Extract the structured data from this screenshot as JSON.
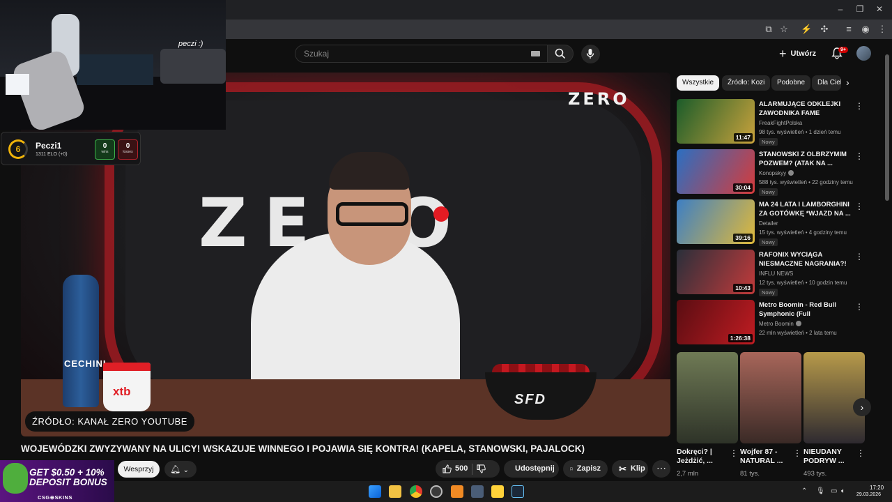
{
  "header": {
    "search_placeholder": "Szukaj",
    "create_label": "Utwórz",
    "notifications_badge": "9+"
  },
  "video": {
    "caption": "ŹRÓDŁO: KANAŁ ZERO YOUTUBE",
    "title": "WOJEWÓDZKI ZWYZYWANY NA ULICY! WSKAZUJE WINNEGO I POJAWIA SIĘ KONTRA! (KAPELA, STANOWSKI, PAJALOCK)",
    "brand_big": "ZERO",
    "brand_small": "ZERO",
    "bottle_label": "CECHINI",
    "mug_label": "xtb",
    "bowl_label": "SFD"
  },
  "actions": {
    "support": "Wesprzyj",
    "likes": "500",
    "share": "Udostępnij",
    "save": "Zapisz",
    "clip": "Klip"
  },
  "chips": [
    "Wszystkie",
    "Źródło: Kozi",
    "Podobne",
    "Dla Ciebie"
  ],
  "recommendations": [
    {
      "title": "ALARMUJĄCE ODKLEJKI ZAWODNIKA FAME (TAŃCULA...",
      "channel": "FreakFightPolska",
      "meta": "98 tys. wyświetleń • 1 dzień temu",
      "badge": "Nowy",
      "duration": "11:47",
      "verified": false,
      "c1": "#1b5c2a",
      "c2": "#c9a23c"
    },
    {
      "title": "STANOWSKI Z OLBRZYMIM POZWEM? (ATAK NA ...",
      "channel": "Konopskyy",
      "meta": "588 tys. wyświetleń • 22 godziny temu",
      "badge": "Nowy",
      "duration": "30:04",
      "verified": true,
      "c1": "#2b6fc2",
      "c2": "#d63b3b"
    },
    {
      "title": "MA 24 LATA I LAMBORGHINI ZA GOTÓWKĘ *WJAZD NA ...",
      "channel": "Detailer",
      "meta": "15 tys. wyświetleń • 4 godziny temu",
      "badge": "Nowy",
      "duration": "39:16",
      "verified": false,
      "c1": "#3d7fc4",
      "c2": "#e0b93a"
    },
    {
      "title": "RAFONIX WYCIĄGA NIESMACZNE NAGRANIA?! ...",
      "channel": "INFLU NEWS",
      "meta": "12 tys. wyświetleń • 10 godzin temu",
      "badge": "Nowy",
      "duration": "10:43",
      "verified": false,
      "c1": "#2a2f3a",
      "c2": "#c23a3a"
    },
    {
      "title": "Metro Boomin - Red Bull Symphonic (Full Performance)",
      "channel": "Metro Boomin",
      "meta": "22 mln wyświetleń • 2 lata temu",
      "badge": "",
      "duration": "1:26:38",
      "verified": true,
      "c1": "#5a0d12",
      "c2": "#c01c22"
    }
  ],
  "shorts": [
    {
      "title": "Dokręci? | Jeżdżić, ...",
      "views": "2,7 mln",
      "c1": "#6f7a55",
      "c2": "#2e3328"
    },
    {
      "title": "Wojfer 87 - NATURAL ...",
      "views": "81 tys.",
      "c1": "#a8665a",
      "c2": "#3a2a26"
    },
    {
      "title": "NIEUDANY PODRYW ...",
      "views": "493 tys.",
      "c1": "#b79a4a",
      "c2": "#2e2a30"
    }
  ],
  "stream": {
    "cam_text": "peczi :)",
    "player_level": "6",
    "player_name": "Peczi1",
    "player_elo": "1311 ELO (+0)",
    "wins": "0",
    "wins_label": "wins",
    "losses": "0",
    "losses_label": "losses"
  },
  "promo": {
    "line1": "GET $0.50 + 10%",
    "line2": "DEPOSIT BONUS",
    "brand": "CSG⊕SKINS"
  },
  "taskbar": {
    "time": "17:20",
    "date": "29.03.2026"
  }
}
